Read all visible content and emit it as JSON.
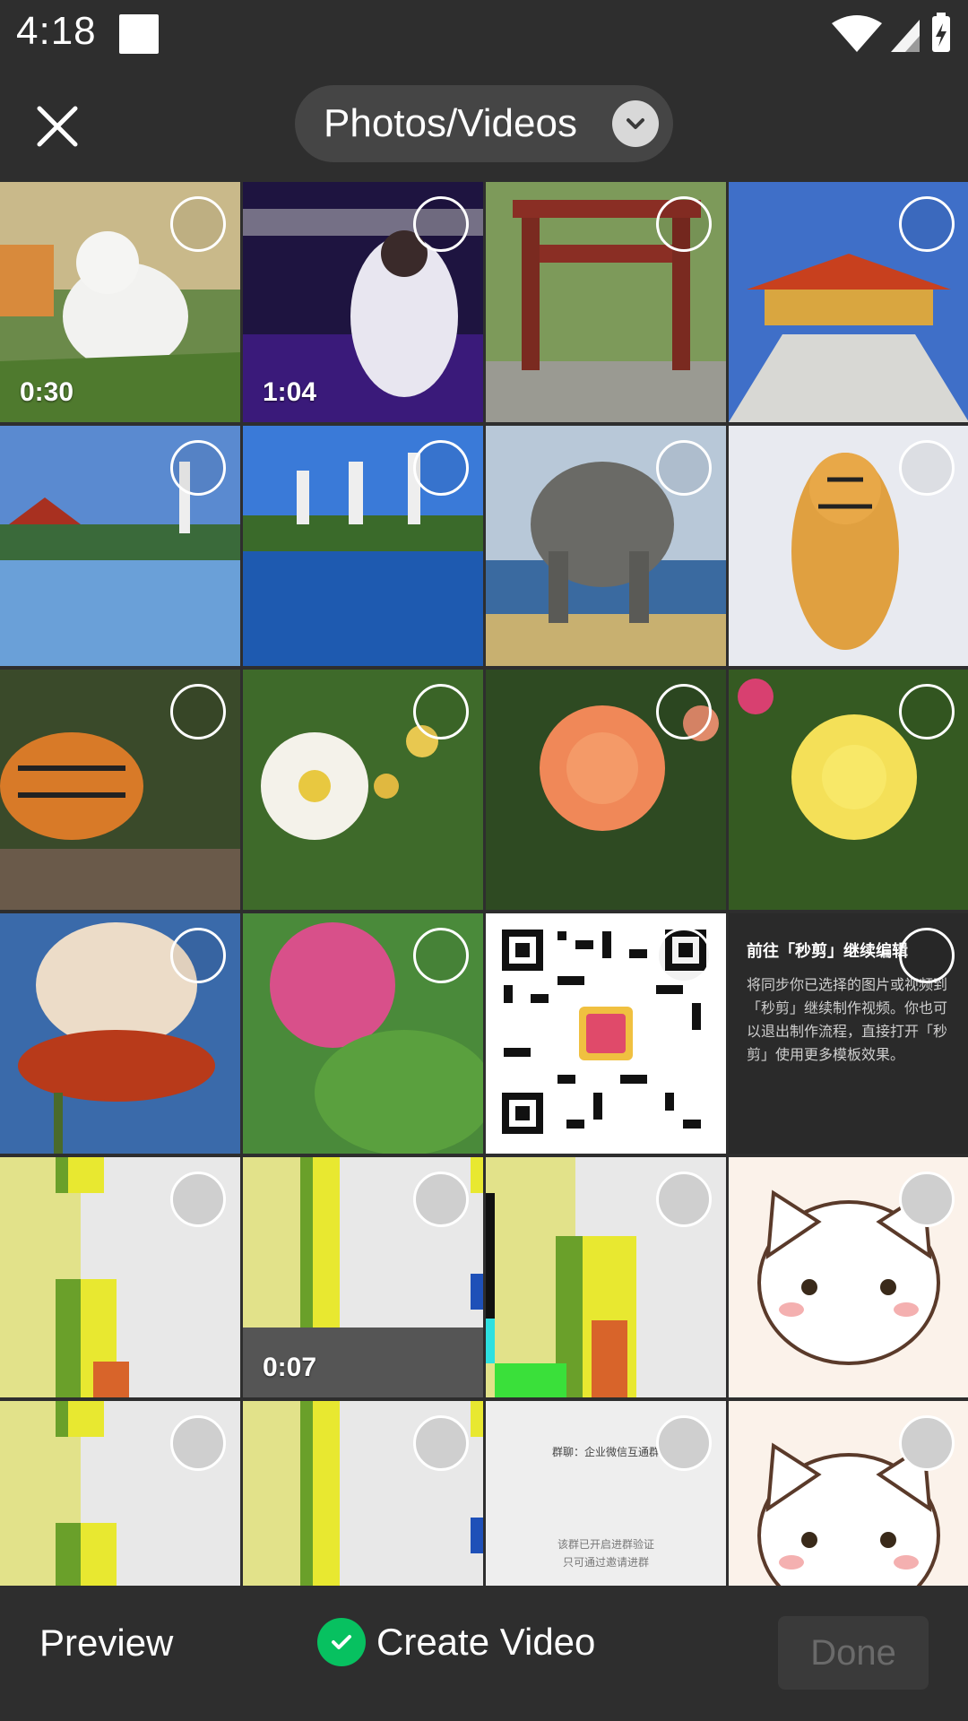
{
  "status_bar": {
    "time": "4:18",
    "icons": [
      "notification-square-icon",
      "wifi-icon",
      "cell-signal-icon",
      "battery-charging-icon"
    ]
  },
  "top_bar": {
    "close_icon": "close-icon",
    "album_label": "Photos/Videos",
    "album_icon": "chevron-down-icon"
  },
  "grid": {
    "tiles": [
      {
        "subject": "white duckling on grass",
        "duration": "0:30"
      },
      {
        "subject": "singer on stage video",
        "duration": "1:04"
      },
      {
        "subject": "red temple gate",
        "duration": ""
      },
      {
        "subject": "temple with stairs",
        "duration": ""
      },
      {
        "subject": "pagodas by lake",
        "duration": ""
      },
      {
        "subject": "three pagodas reflection",
        "duration": ""
      },
      {
        "subject": "elephant by water",
        "duration": ""
      },
      {
        "subject": "tiger in snow",
        "duration": ""
      },
      {
        "subject": "tiger walking",
        "duration": ""
      },
      {
        "subject": "white rose",
        "duration": ""
      },
      {
        "subject": "orange rose",
        "duration": ""
      },
      {
        "subject": "yellow rose",
        "duration": ""
      },
      {
        "subject": "orchid",
        "duration": ""
      },
      {
        "subject": "pink flowers",
        "duration": ""
      },
      {
        "subject": "QR code",
        "duration": ""
      },
      {
        "subject": "miaojian notice",
        "duration": "",
        "title": "前往「秒剪」继续编辑",
        "body": "将同步你已选择的图片或视频到「秒剪」继续制作视频。你也可以退出制作流程，直接打开「秒剪」使用更多模板效果。"
      },
      {
        "subject": "pixel chart",
        "duration": ""
      },
      {
        "subject": "pixel chart video",
        "duration": "0:07"
      },
      {
        "subject": "pixel chart colored",
        "duration": ""
      },
      {
        "subject": "white cat sticker",
        "duration": ""
      },
      {
        "subject": "pixel chart",
        "duration": ""
      },
      {
        "subject": "pixel chart",
        "duration": ""
      },
      {
        "subject": "group screenshot",
        "duration": "",
        "line1": "群聊：企业微信互通群",
        "line2a": "该群已开启进群验证",
        "line2b": "只可通过邀请进群"
      },
      {
        "subject": "white cat sticker",
        "duration": ""
      }
    ]
  },
  "bottom_bar": {
    "preview_label": "Preview",
    "create_label": "Create Video",
    "create_icon": "check-circle-icon",
    "done_label": "Done"
  },
  "colors": {
    "background": "#2e2e2e",
    "accent_green": "#07c160",
    "pill_bg": "#454545",
    "done_disabled": "#3a3a3a"
  }
}
